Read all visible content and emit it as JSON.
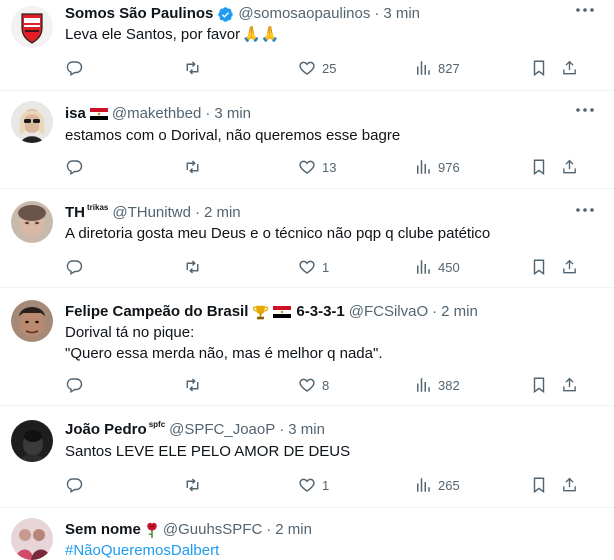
{
  "tweets": [
    {
      "name": "Somos São Paulinos",
      "verified": true,
      "handle": "@somosaopaulinos",
      "dot": "·",
      "time": "3 min",
      "text": "Leva ele Santos, por favor",
      "emoji": "🙏🙏",
      "likes": "25",
      "views": "827",
      "avatar_icon": "sao-paulo-crest"
    },
    {
      "name": "isa",
      "flag": "egypt-flag",
      "handle": "@makethbed",
      "dot": "·",
      "time": "3 min",
      "text": "estamos com o Dorival, não queremos esse bagre",
      "likes": "13",
      "views": "976",
      "avatar_icon": "woman-sunglasses-photo"
    },
    {
      "name": "TH",
      "name_sup": "trikas",
      "handle": "@THunitwd",
      "dot": "·",
      "time": "2 min",
      "text": "A diretoria gosta meu Deus e o técnico não pqp q clube patético",
      "likes": "1",
      "views": "450",
      "avatar_icon": "blurred-face-photo"
    },
    {
      "name": "Felipe Campeão do Brasil",
      "trophy": "trophy-icon",
      "flag": "egypt-flag",
      "name_suffix": "6-3-3-1",
      "handle": "@FCSilvaO",
      "dot": "·",
      "time": "2 min",
      "text_lines": [
        "Dorival tá no pique:",
        "\"Quero essa merda não, mas é melhor q nada\"."
      ],
      "likes": "8",
      "views": "382",
      "avatar_icon": "man-face-photo"
    },
    {
      "name": "João Pedro",
      "name_sup": "spfc",
      "handle": "@SPFC_JoaoP",
      "dot": "·",
      "time": "3 min",
      "text": "Santos LEVE ELE PELO AMOR DE DEUS",
      "likes": "1",
      "views": "265",
      "avatar_icon": "dark-profile-photo"
    },
    {
      "name": "Sem nome",
      "rose": "rose-icon",
      "handle": "@GuuhsSPFC",
      "dot": "·",
      "time": "2 min",
      "hashtag": "#NãoQueremosDalbert",
      "avatar_icon": "group-photo"
    }
  ],
  "colors": {
    "text": "#0f1419",
    "secondary": "#536471",
    "link": "#1d9bf0",
    "verified": "#1d9bf0",
    "border": "#eff3f4"
  }
}
